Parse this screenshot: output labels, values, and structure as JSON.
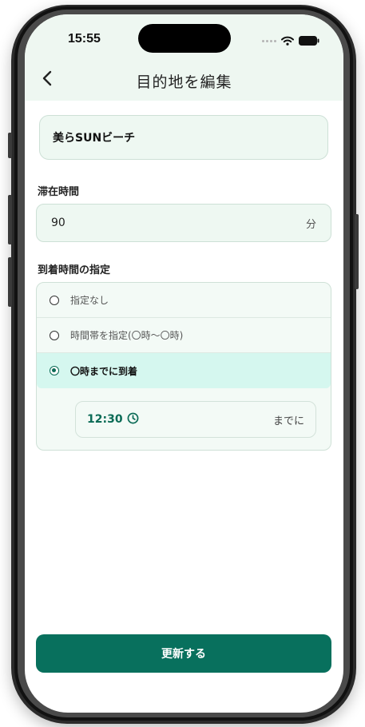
{
  "status_bar": {
    "time": "15:55"
  },
  "header": {
    "title": "目的地を編集"
  },
  "destination": {
    "value": "美らSUNビーチ"
  },
  "stay": {
    "label": "滞在時間",
    "value": "90",
    "unit": "分"
  },
  "arrival": {
    "label": "到着時間の指定",
    "options": [
      {
        "label": "指定なし",
        "selected": false
      },
      {
        "label": "時間帯を指定(〇時〜〇時)",
        "selected": false
      },
      {
        "label": "〇時までに到着",
        "selected": true
      }
    ],
    "time_value": "12:30",
    "time_suffix": "までに"
  },
  "update_button": {
    "label": "更新する"
  },
  "colors": {
    "accent": "#08705d",
    "header_bg": "#eef7f1",
    "selected_bg": "#d5f7ef"
  },
  "icons": [
    "chevron-left-icon",
    "wifi-icon",
    "battery-icon",
    "clock-icon"
  ]
}
